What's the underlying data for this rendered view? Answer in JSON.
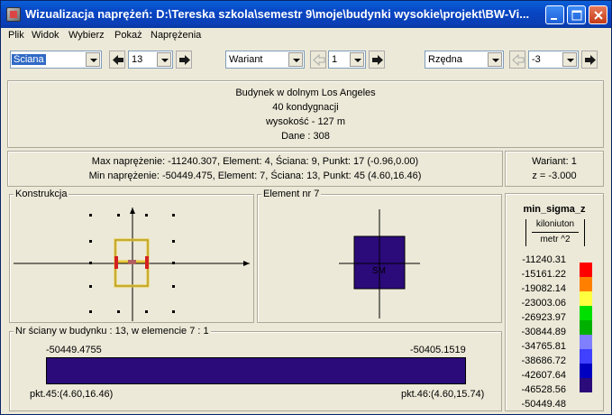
{
  "window": {
    "title": "Wizualizacja naprężeń: D:\\Tereska szkola\\semestr  9\\moje\\budynki wysokie\\projekt\\BW-Vi..."
  },
  "menu": [
    "Plik",
    "Widok",
    "Wybierz",
    "Pokaż",
    "Naprężenia"
  ],
  "toolbar": {
    "type_select": "Ściana",
    "number_select": "13",
    "variant_select": "Wariant",
    "variant_number": "1",
    "ordinate_select": "Rzędna",
    "ordinate_value": "-3"
  },
  "building_info": {
    "line1": "Budynek w dolnym Los Angeles",
    "line2": "40 kondygnacji",
    "line3": "wysokość - 127 m",
    "line4": "Dane :    308"
  },
  "stress_summary": {
    "max_line": "Max naprężenie: -11240.307,   Element: 4,   Ściana: 9,   Punkt: 17 (-0.96,0.00)",
    "min_line": "Min naprężenie: -50449.475,   Element: 7,   Ściana: 13,   Punkt: 45 (4.60,16.46)"
  },
  "variant_info": {
    "variant": "Wariant: 1",
    "z": "z = -3.000"
  },
  "construction_panel": {
    "label": "Konstrukcja"
  },
  "element_panel": {
    "label": "Element nr 7",
    "center_label": "SM"
  },
  "wall_panel": {
    "label": "Nr ściany w budynku :  13,   w elemencie 7 :  1",
    "value_left": "-50449.4755",
    "value_right": "-50405.1519",
    "point_left": "pkt.45:(4.60,16.46)",
    "point_right": "pkt.46:(4.60,15.74)",
    "bar_color": "#2b0a7a"
  },
  "legend": {
    "title": "min_sigma_z",
    "unit_top": "kiloniuton",
    "unit_bottom": "metr ^2",
    "values": [
      "-11240.31",
      "-15161.22",
      "-19082.14",
      "-23003.06",
      "-26923.97",
      "-30844.89",
      "-34765.81",
      "-38686.72",
      "-42607.64",
      "-46528.56",
      "-50449.48"
    ],
    "colors": [
      "#ff0000",
      "#ff8000",
      "#ffff40",
      "#00e000",
      "#00b000",
      "#8080ff",
      "#4040ff",
      "#0000c0",
      "#2b0a7a"
    ]
  }
}
